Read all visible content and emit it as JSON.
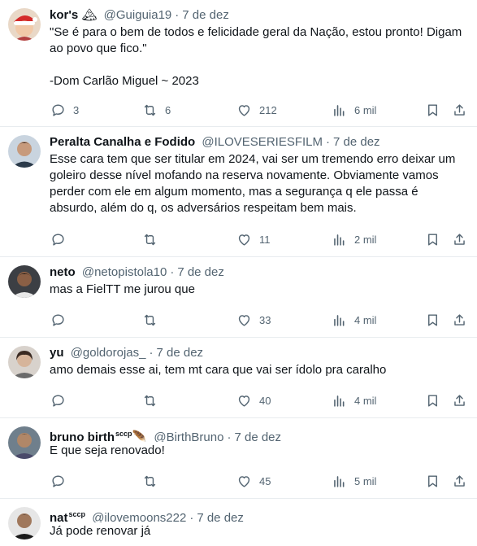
{
  "tweets": [
    {
      "name": "kor's",
      "handle": "@Guiguia19",
      "date": "7 de dez",
      "text": "\"Se é para o bem de todos e felicidade geral da Nação, estou pronto! Digam ao povo que fico.\"\n\n-Dom Carlão Miguel ~ 2023",
      "replies": "3",
      "retweets": "6",
      "likes": "212",
      "views": "6 mil",
      "avatar_icon": "santa-hat-avatar-icon"
    },
    {
      "name": "Peralta Canalha e Fodido",
      "handle": "@ILOVESERIESFILM",
      "date": "7 de dez",
      "text": "Esse cara tem que ser titular em 2024, vai ser um tremendo erro deixar um goleiro desse nível mofando na reserva novamente. Obviamente vamos perder com ele em algum momento, mas a segurança q ele passa é absurdo, além do q, os adversários respeitam bem mais.",
      "replies": "",
      "retweets": "",
      "likes": "11",
      "views": "2 mil",
      "avatar_icon": "person-avatar-icon"
    },
    {
      "name": "neto",
      "handle": "@netopistola10",
      "date": "7 de dez",
      "text": "mas a FielTT me jurou que",
      "replies": "",
      "retweets": "",
      "likes": "33",
      "views": "4 mil",
      "avatar_icon": "person-avatar-icon"
    },
    {
      "name": "yu",
      "handle": "@goldorojas_",
      "date": "7 de dez",
      "text": "amo demais esse ai, tem mt cara que vai ser ídolo pra caralho",
      "replies": "",
      "retweets": "",
      "likes": "40",
      "views": "4 mil",
      "avatar_icon": "person-avatar-icon"
    },
    {
      "name": "bruno birth",
      "name_badge": "sccp",
      "name_emoji": "🪶",
      "handle": "@BirthBruno",
      "date": "7 de dez",
      "text": "E que seja renovado!",
      "replies": "",
      "retweets": "",
      "likes": "45",
      "views": "5 mil",
      "avatar_icon": "person-avatar-icon"
    },
    {
      "name": "nat",
      "name_badge": "sccp",
      "handle": "@ilovemoons222",
      "date": "7 de dez",
      "text": "Já pode renovar já",
      "avatar_icon": "person-avatar-icon"
    }
  ],
  "colors": {
    "text_primary": "#0f1419",
    "text_secondary": "#536471",
    "divider": "#e8ecef"
  }
}
